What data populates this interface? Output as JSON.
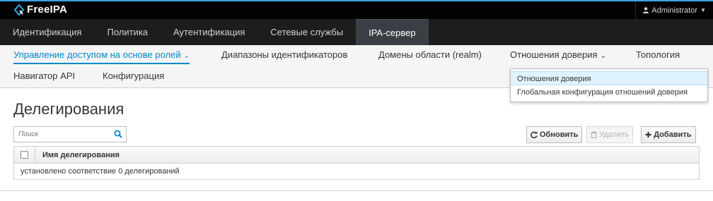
{
  "header": {
    "logo_text": "FreeIPA",
    "user_label": "Administrator",
    "brand_color": "#39a5dc"
  },
  "primary_nav": {
    "items": [
      {
        "label": "Идентификация"
      },
      {
        "label": "Политика"
      },
      {
        "label": "Аутентификация"
      },
      {
        "label": "Сетевые службы"
      },
      {
        "label": "IPA-сервер",
        "active": true
      }
    ]
  },
  "secondary_nav": {
    "items": [
      {
        "label": "Управление доступом на основе ролей",
        "active": true,
        "has_dropdown": true
      },
      {
        "label": "Диапазоны идентификаторов"
      },
      {
        "label": "Домены области (realm)"
      },
      {
        "label": "Отношения доверия",
        "has_dropdown": true,
        "open": true
      },
      {
        "label": "Топология"
      },
      {
        "label": "Навигатор API"
      },
      {
        "label": "Конфигурация"
      }
    ]
  },
  "dropdown": {
    "items": [
      {
        "label": "Отношения доверия",
        "selected": true
      },
      {
        "label": "Глобальная конфигурация отношений доверия"
      }
    ]
  },
  "page": {
    "title": "Делегирования"
  },
  "search": {
    "placeholder": "Поиск",
    "value": ""
  },
  "toolbar": {
    "refresh_label": "Обновить",
    "delete_label": "Удалить",
    "add_label": "Добавить"
  },
  "table": {
    "columns": [
      "Имя делегирования"
    ],
    "rows": [],
    "summary": "установлено соответствие 0 делегирований"
  },
  "icons": {
    "logo": "freeipa-logo-icon",
    "user": "user-icon",
    "search": "search-icon",
    "refresh": "refresh-icon",
    "delete": "trash-icon",
    "add": "plus-icon"
  }
}
